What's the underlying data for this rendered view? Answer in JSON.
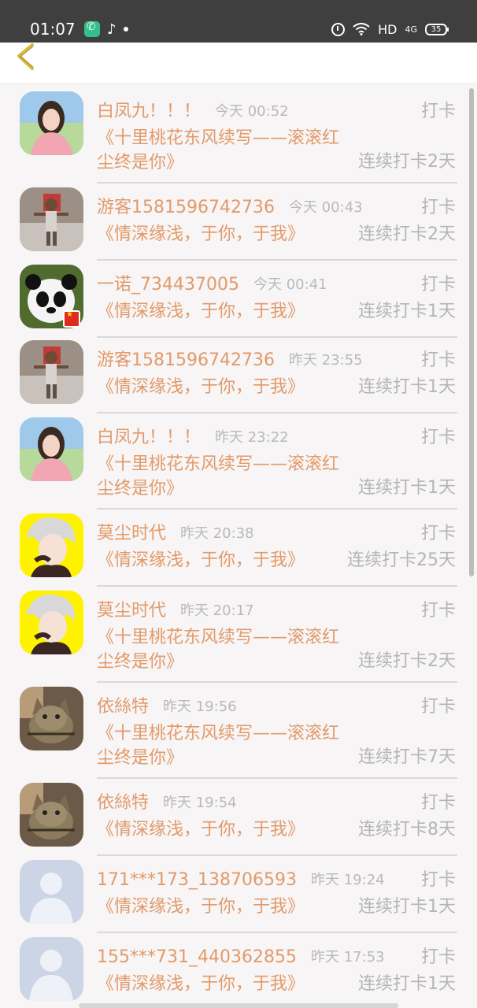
{
  "status_bar": {
    "time": "01:07",
    "network_label": "HD",
    "signal_label": "4G",
    "battery": "35"
  },
  "colors": {
    "accent": "#e29a6a",
    "muted": "#b5b5b5",
    "status_bar": "#3f3f3f"
  },
  "icons": {
    "back": "chevron-left-icon",
    "phone": "phone-icon",
    "tiktok": "tiktok-icon",
    "alarm": "alarm-icon",
    "wifi": "wifi-icon",
    "battery": "battery-icon"
  },
  "entries": [
    {
      "name": "白凤九！！！",
      "time": "今天 00:52",
      "action": "打卡",
      "work_line1": "《十里桃花东风续写——滚滚红",
      "work_line2": "尘终是你》",
      "streak": "连续打卡2天",
      "avatar": "woman"
    },
    {
      "name": "游客1581596742736",
      "time": "今天 00:43",
      "action": "打卡",
      "work_line1": "《情深缘浅，于你，于我》",
      "work_line2": "",
      "streak": "连续打卡2天",
      "avatar": "child"
    },
    {
      "name": "一诺_734437005",
      "time": "今天 00:41",
      "action": "打卡",
      "work_line1": "《情深缘浅，于你，于我》",
      "work_line2": "",
      "streak": "连续打卡1天",
      "avatar": "panda"
    },
    {
      "name": "游客1581596742736",
      "time": "昨天 23:55",
      "action": "打卡",
      "work_line1": "《情深缘浅，于你，于我》",
      "work_line2": "",
      "streak": "连续打卡1天",
      "avatar": "child"
    },
    {
      "name": "白凤九！！！",
      "time": "昨天 23:22",
      "action": "打卡",
      "work_line1": "《十里桃花东风续写——滚滚红",
      "work_line2": "尘终是你》",
      "streak": "连续打卡1天",
      "avatar": "woman"
    },
    {
      "name": "莫尘时代",
      "time": "昨天 20:38",
      "action": "打卡",
      "work_line1": "《情深缘浅，于你，于我》",
      "work_line2": "",
      "streak": "连续打卡25天",
      "avatar": "anime"
    },
    {
      "name": "莫尘时代",
      "time": "昨天 20:17",
      "action": "打卡",
      "work_line1": "《十里桃花东风续写——滚滚红",
      "work_line2": "尘终是你》",
      "streak": "连续打卡2天",
      "avatar": "anime"
    },
    {
      "name": "依絲特",
      "time": "昨天 19:56",
      "action": "打卡",
      "work_line1": "《十里桃花东风续写——滚滚红",
      "work_line2": "尘终是你》",
      "streak": "连续打卡7天",
      "avatar": "cat"
    },
    {
      "name": "依絲特",
      "time": "昨天 19:54",
      "action": "打卡",
      "work_line1": "《情深缘浅，于你，于我》",
      "work_line2": "",
      "streak": "连续打卡8天",
      "avatar": "cat"
    },
    {
      "name": "171***173_138706593",
      "time": "昨天 19:24",
      "action": "打卡",
      "work_line1": "《情深缘浅，于你，于我》",
      "work_line2": "",
      "streak": "连续打卡1天",
      "avatar": "default"
    },
    {
      "name": "155***731_440362855",
      "time": "昨天 17:53",
      "action": "打卡",
      "work_line1": "《情深缘浅，于你，于我》",
      "work_line2": "",
      "streak": "连续打卡1天",
      "avatar": "default"
    }
  ]
}
